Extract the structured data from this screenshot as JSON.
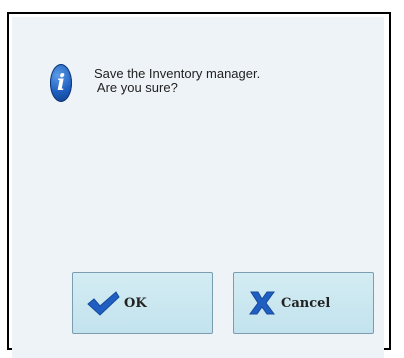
{
  "dialog": {
    "icon": "info-icon",
    "message_line1": "Save the Inventory manager.",
    "message_line2": " Are you sure?"
  },
  "buttons": {
    "ok_label": "OK",
    "ok_icon": "checkmark-icon",
    "cancel_label": "Cancel",
    "cancel_icon": "x-mark-icon"
  },
  "colors": {
    "dialog_background": "#eef3f7",
    "button_background": "#c8e6f0",
    "checkmark": "#1f5fc2",
    "x_mark": "#1f5fc2",
    "info_icon": "#1e5fbf"
  }
}
